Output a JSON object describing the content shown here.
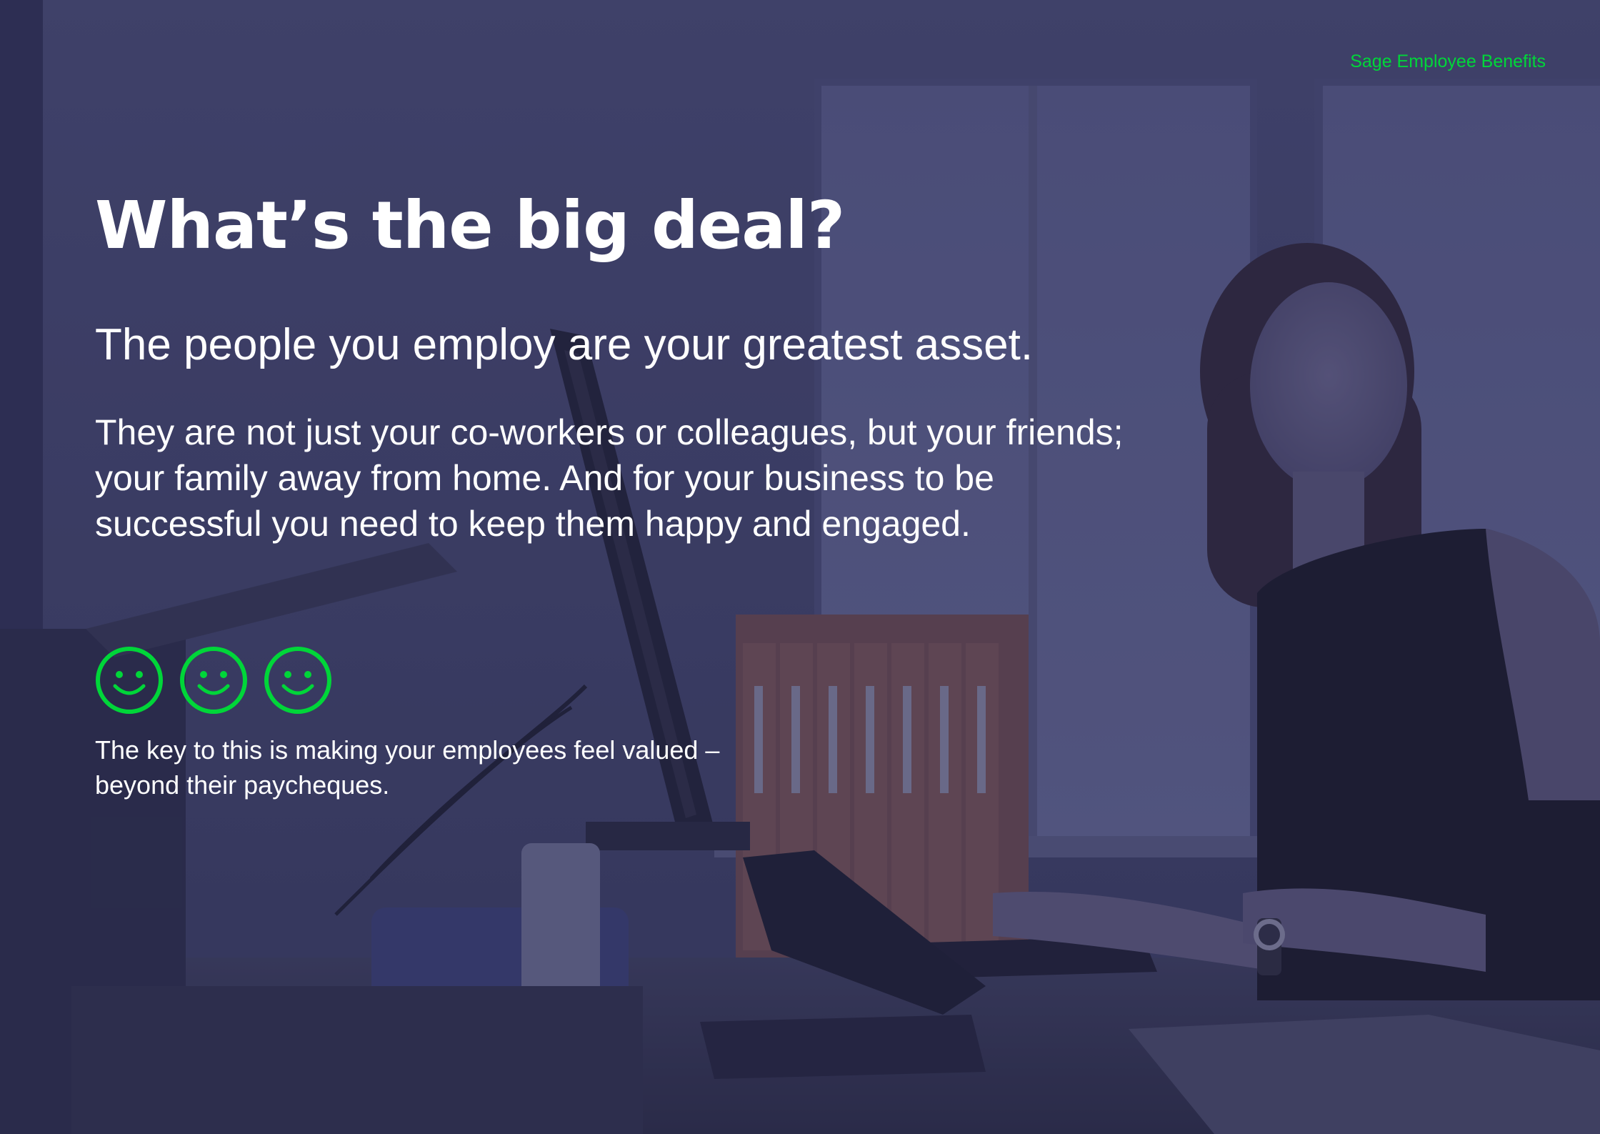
{
  "brand": {
    "text": "Sage Employee Benefits",
    "color": "#00d639"
  },
  "heading": "What’s the big deal?",
  "lead": "The people you employ are your greatest asset.",
  "body": "They are not just your co-workers or colleagues, but your friends; your family away from home. And for your business to be successful you need to keep them happy and engaged.",
  "icons": [
    "smiley-face-icon",
    "smiley-face-icon",
    "smiley-face-icon"
  ],
  "accent_color": "#00d639",
  "caption": "The key to this is making your employees feel valued – beyond their paycheques."
}
